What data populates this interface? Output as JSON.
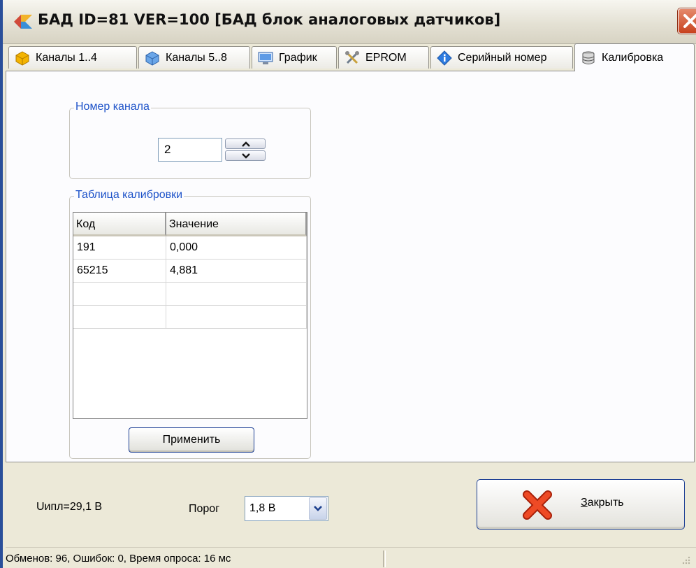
{
  "window": {
    "title": "БАД ID=81 VER=100 [БАД блок аналоговых датчиков]"
  },
  "tabs": [
    {
      "label": "Каналы 1..4",
      "icon": "yellow-box-icon"
    },
    {
      "label": "Каналы 5..8",
      "icon": "blue-box-icon"
    },
    {
      "label": "График",
      "icon": "monitor-icon"
    },
    {
      "label": "EPROM",
      "icon": "tools-icon"
    },
    {
      "label": "Серийный номер",
      "icon": "info-icon"
    },
    {
      "label": "Калибровка",
      "icon": "database-icon",
      "active": true
    }
  ],
  "channel_group": {
    "legend": "Номер канала",
    "value": "2"
  },
  "calibration_group": {
    "legend": "Таблица калибровки",
    "columns": [
      "Код",
      "Значение"
    ],
    "rows": [
      [
        "191",
        "0,000"
      ],
      [
        "65215",
        "4,881"
      ],
      [
        "",
        ""
      ],
      [
        "",
        ""
      ]
    ],
    "apply_label": "Применить"
  },
  "bottom": {
    "voltage": "Uипл=29,1 В",
    "threshold_label": "Порог",
    "threshold_value": "1,8 В",
    "close_label_hotkey": "З",
    "close_label_rest": "акрыть"
  },
  "status": {
    "text": "Обменов: 96, Ошибок: 0, Время опроса: 16 мс"
  },
  "colors": {
    "accent_blue": "#1e53c9",
    "close_red": "#e23b1b",
    "window_bg": "#ece9d8"
  }
}
